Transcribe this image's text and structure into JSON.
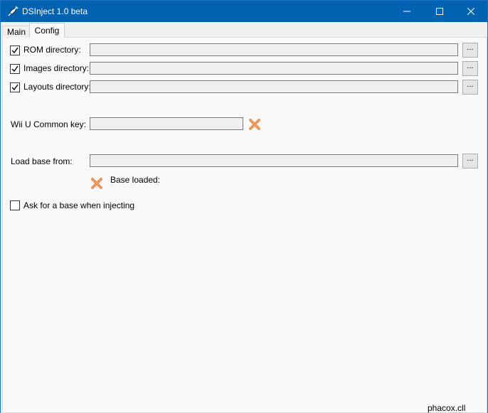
{
  "window": {
    "title": "DSInject 1.0 beta",
    "icons": {
      "app": "syringe-icon",
      "minimize": "minimize-icon",
      "maximize": "maximize-icon",
      "close": "close-icon"
    }
  },
  "tabs": [
    {
      "label": "Main",
      "selected": false
    },
    {
      "label": "Config",
      "selected": true
    }
  ],
  "config": {
    "rom_directory": {
      "label": "ROM directory:",
      "checked": true,
      "value": "",
      "browse_label": "..."
    },
    "images_directory": {
      "label": "Images directory:",
      "checked": true,
      "value": "",
      "browse_label": "..."
    },
    "layouts_directory": {
      "label": "Layouts directory:",
      "checked": true,
      "value": "",
      "browse_label": "..."
    },
    "common_key": {
      "label": "Wii U Common key:",
      "value": "",
      "status_icon": "cross-icon"
    },
    "load_base": {
      "label": "Load base from:",
      "value": "",
      "browse_label": "...",
      "status_icon": "cross-icon",
      "status_text": "Base loaded:"
    },
    "ask_base": {
      "label": "Ask for a base when injecting",
      "checked": false
    }
  },
  "footer": {
    "credit": "phacox.cll"
  },
  "colors": {
    "titlebar": "#0063b1",
    "status_cross": "#e9975a"
  }
}
